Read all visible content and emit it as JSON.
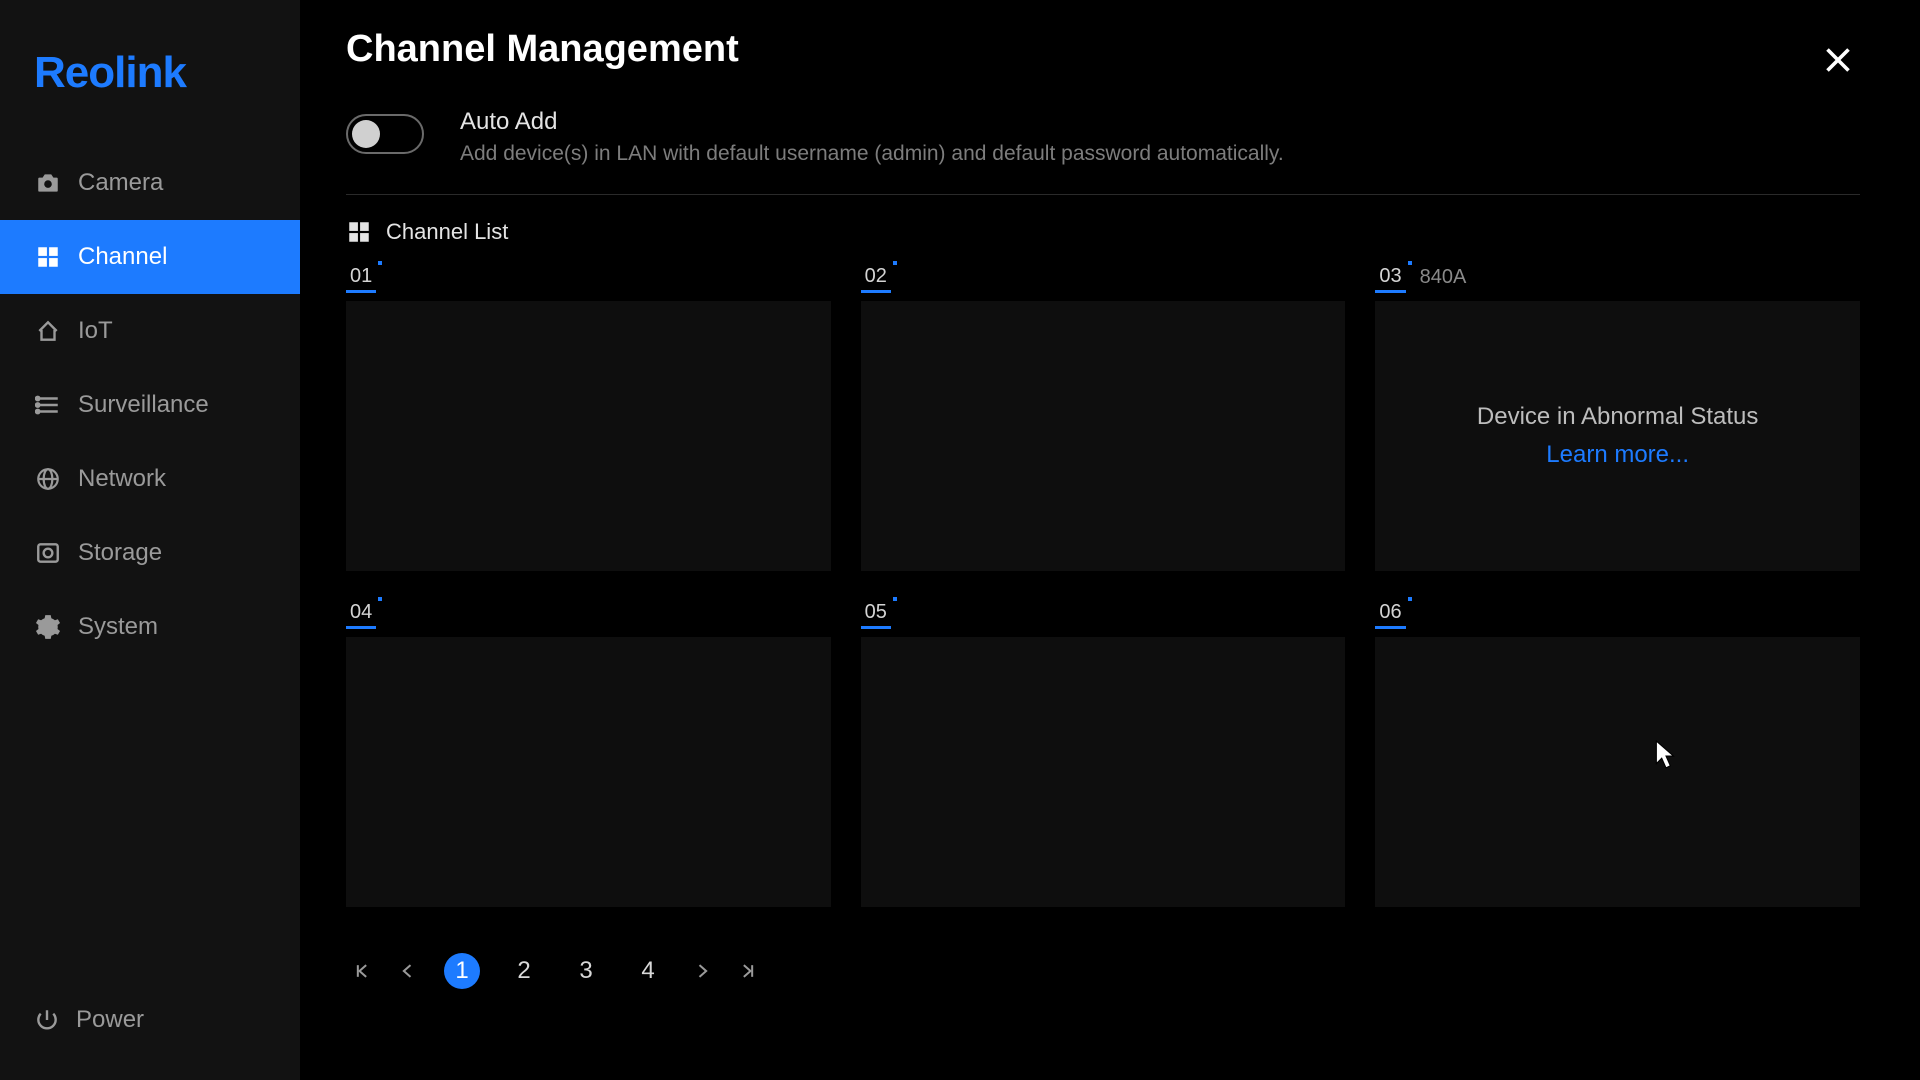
{
  "brand": "Reolink",
  "sidebar": {
    "items": [
      {
        "id": "camera",
        "label": "Camera"
      },
      {
        "id": "channel",
        "label": "Channel"
      },
      {
        "id": "iot",
        "label": "IoT"
      },
      {
        "id": "surveillance",
        "label": "Surveillance"
      },
      {
        "id": "network",
        "label": "Network"
      },
      {
        "id": "storage",
        "label": "Storage"
      },
      {
        "id": "system",
        "label": "System"
      }
    ],
    "active": "channel",
    "power": "Power"
  },
  "page": {
    "title": "Channel Management",
    "auto_add": {
      "enabled": false,
      "title": "Auto Add",
      "description": "Add device(s) in LAN with default username (admin) and default password automatically."
    },
    "section_title": "Channel List",
    "channels": [
      {
        "num": "01",
        "label": ""
      },
      {
        "num": "02",
        "label": ""
      },
      {
        "num": "03",
        "label": "840A",
        "abnormal": true
      },
      {
        "num": "04",
        "label": ""
      },
      {
        "num": "05",
        "label": ""
      },
      {
        "num": "06",
        "label": ""
      }
    ],
    "abnormal": {
      "message": "Device in Abnormal Status",
      "link": "Learn more..."
    },
    "pagination": {
      "pages": [
        "1",
        "2",
        "3",
        "4"
      ],
      "current": "1"
    }
  }
}
